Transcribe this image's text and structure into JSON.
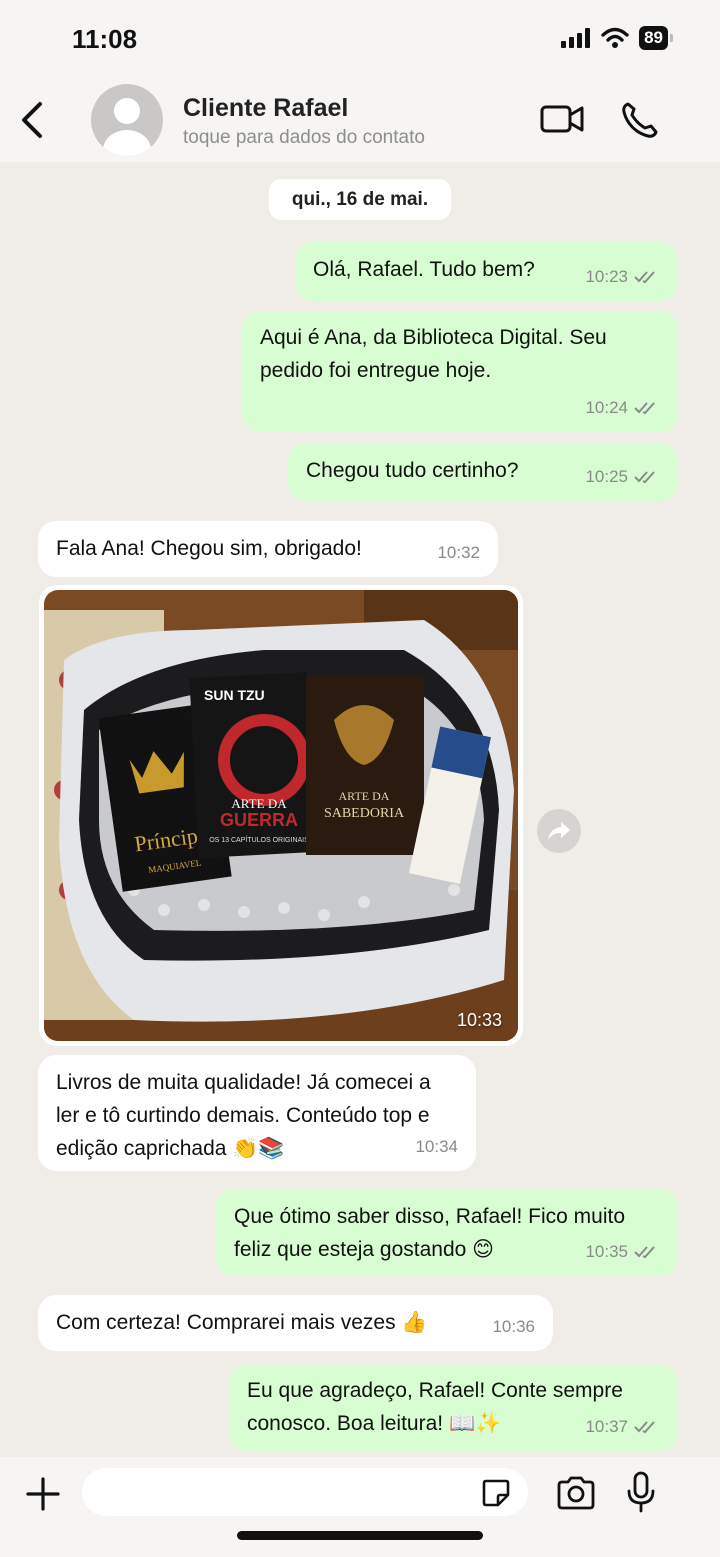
{
  "status_bar": {
    "time": "11:08",
    "battery": "89"
  },
  "header": {
    "name": "Cliente Rafael",
    "subtitle": "toque para dados do contato"
  },
  "date_chip": "qui., 16 de mai.",
  "messages": [
    {
      "dir": "out",
      "text": "Olá, Rafael. Tudo bem?",
      "time": "10:23"
    },
    {
      "dir": "out",
      "text": "Aqui é Ana, da Biblioteca Digital. Seu pedido foi entregue hoje.",
      "time": "10:24"
    },
    {
      "dir": "out",
      "text": "Chegou tudo certinho?",
      "time": "10:25"
    },
    {
      "dir": "in",
      "text": "Fala Ana! Chegou sim, obrigado!",
      "time": "10:32"
    },
    {
      "dir": "in",
      "type": "photo",
      "time": "10:33",
      "photo_text": {
        "book1_title": "Príncipe",
        "book1_author": "MAQUIAVEL",
        "book2_author": "SUN TZU",
        "book2_title_1": "ARTE DA",
        "book2_title_2": "GUERRA",
        "book2_sub": "OS 13 CAPÍTULOS ORIGINAIS",
        "book3_title_1": "ARTE DA",
        "book3_title_2": "SABEDORIA"
      }
    },
    {
      "dir": "in",
      "text": "Livros de muita qualidade! Já comecei a ler e tô curtindo demais. Conteúdo top e edição caprichada 👏📚",
      "time": "10:34"
    },
    {
      "dir": "out",
      "text": "Que ótimo saber disso, Rafael! Fico muito feliz que esteja gostando 😊",
      "time": "10:35"
    },
    {
      "dir": "in",
      "text": "Com certeza! Comprarei mais vezes 👍",
      "time": "10:36"
    },
    {
      "dir": "out",
      "text": "Eu que agradeço, Rafael! Conte sempre conosco. Boa leitura! 📖✨",
      "time": "10:37"
    }
  ],
  "input": {
    "placeholder": ""
  },
  "colors": {
    "outgoing": "#d9fdd3",
    "incoming": "#ffffff",
    "background": "#f0ede8",
    "read_check": "#8a8a8a"
  }
}
